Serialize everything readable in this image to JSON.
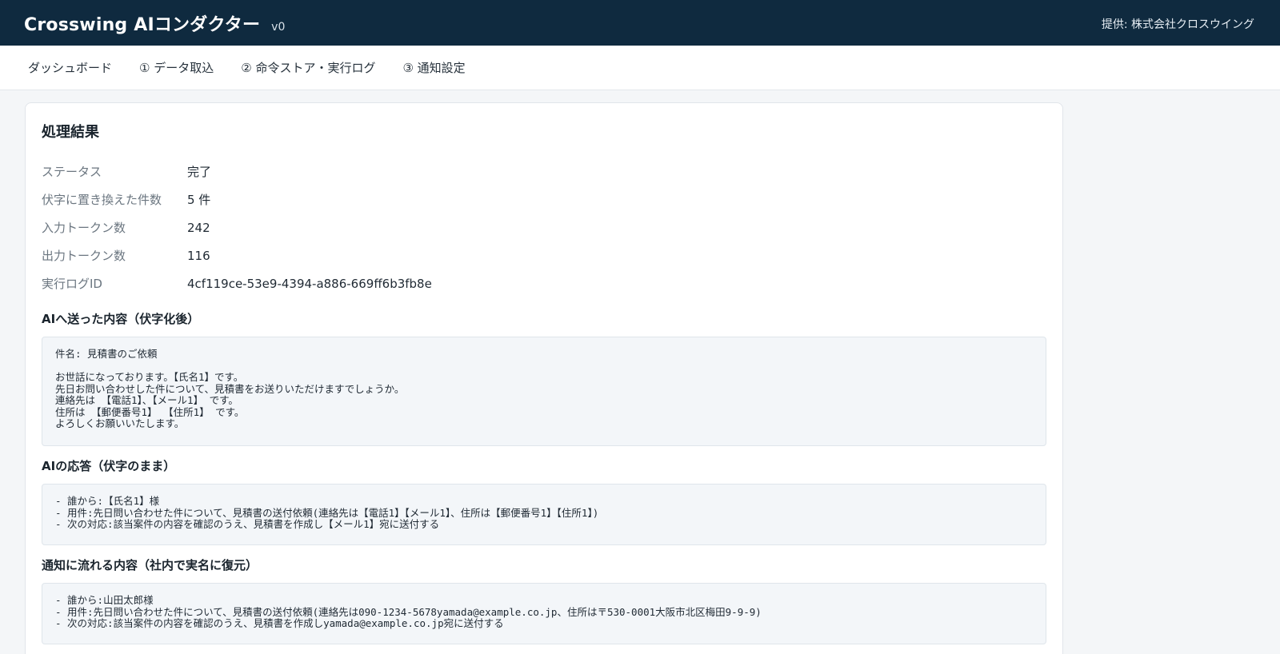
{
  "app": {
    "title": "Crosswing AIコンダクター",
    "version": "v0",
    "provider": "提供: 株式会社クロスウイング"
  },
  "nav": {
    "items": [
      {
        "label": "ダッシュボード"
      },
      {
        "label": "① データ取込"
      },
      {
        "label": "② 命令ストア・実行ログ"
      },
      {
        "label": "③ 通知設定"
      }
    ]
  },
  "result": {
    "title": "処理結果",
    "rows": [
      {
        "label": "ステータス",
        "value": "完了"
      },
      {
        "label": "伏字に置き換えた件数",
        "value": "5 件"
      },
      {
        "label": "入力トークン数",
        "value": "242"
      },
      {
        "label": "出力トークン数",
        "value": "116"
      },
      {
        "label": "実行ログID",
        "value": "4cf119ce-53e9-4394-a886-669ff6b3fb8e"
      }
    ]
  },
  "sections": {
    "sent": {
      "title": "AIへ送った内容（伏字化後）",
      "body": "件名: 見積書のご依頼\n\nお世話になっております。【氏名1】です。\n先日お問い合わせした件について、見積書をお送りいただけますでしょうか。\n連絡先は 【電話1】、【メール1】 です。\n住所は 【郵便番号1】 【住所1】 です。\nよろしくお願いいたします。"
    },
    "response": {
      "title": "AIの応答（伏字のまま）",
      "body": "- 誰から:【氏名1】様\n- 用件:先日問い合わせた件について、見積書の送付依頼(連絡先は【電話1】【メール1】、住所は【郵便番号1】【住所1】)\n- 次の対応:該当案件の内容を確認のうえ、見積書を作成し【メール1】宛に送付する"
    },
    "notify": {
      "title": "通知に流れる内容（社内で実名に復元）",
      "body": "- 誰から:山田太郎様\n- 用件:先日問い合わせた件について、見積書の送付依頼(連絡先は090-1234-5678yamada@example.co.jp、住所は〒530-0001大阪市北区梅田9-9-9)\n- 次の対応:該当案件の内容を確認のうえ、見積書を作成しyamada@example.co.jp宛に送付する"
    }
  }
}
